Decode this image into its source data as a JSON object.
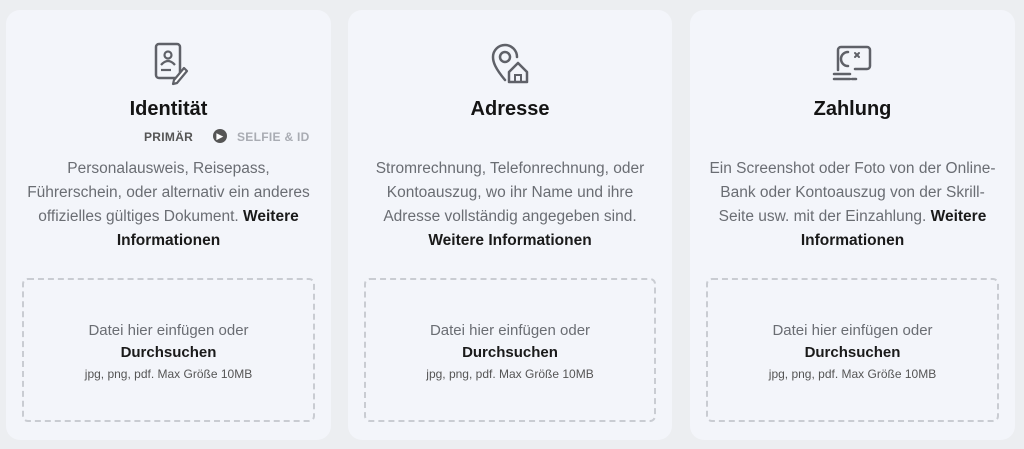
{
  "cards": [
    {
      "icon": "id-card-icon",
      "title": "Identität",
      "steps": [
        "PRIMÄR",
        "SELFIE & ID"
      ],
      "description": "Personalausweis, Reisepass, Führerschein, oder alternativ ein anderes offizielles gültiges Dokument.",
      "more_link": "Weitere Informationen",
      "drop_hint": "Datei hier einfügen oder",
      "browse": "Durchsuchen",
      "limits": "jpg, png, pdf. Max Größe 10MB"
    },
    {
      "icon": "location-home-icon",
      "title": "Adresse",
      "description": "Stromrechnung, Telefonrechnung, oder Kontoauszug, wo ihr Name und ihre Adresse vollständig angegeben sind.",
      "more_link": "Weitere Informationen",
      "drop_hint": "Datei hier einfügen oder",
      "browse": "Durchsuchen",
      "limits": "jpg, png, pdf. Max Größe 10MB"
    },
    {
      "icon": "payment-card-icon",
      "title": "Zahlung",
      "description": "Ein Screenshot oder Foto von der Online-Bank oder Kontoauszug von der Skrill-Seite usw. mit der Einzahlung.",
      "more_link": "Weitere Informationen",
      "drop_hint": "Datei hier einfügen oder",
      "browse": "Durchsuchen",
      "limits": "jpg, png, pdf. Max Größe 10MB"
    }
  ],
  "colors": {
    "background": "#eceef1",
    "card": "#f3f5fa",
    "icon": "#5f6168"
  }
}
